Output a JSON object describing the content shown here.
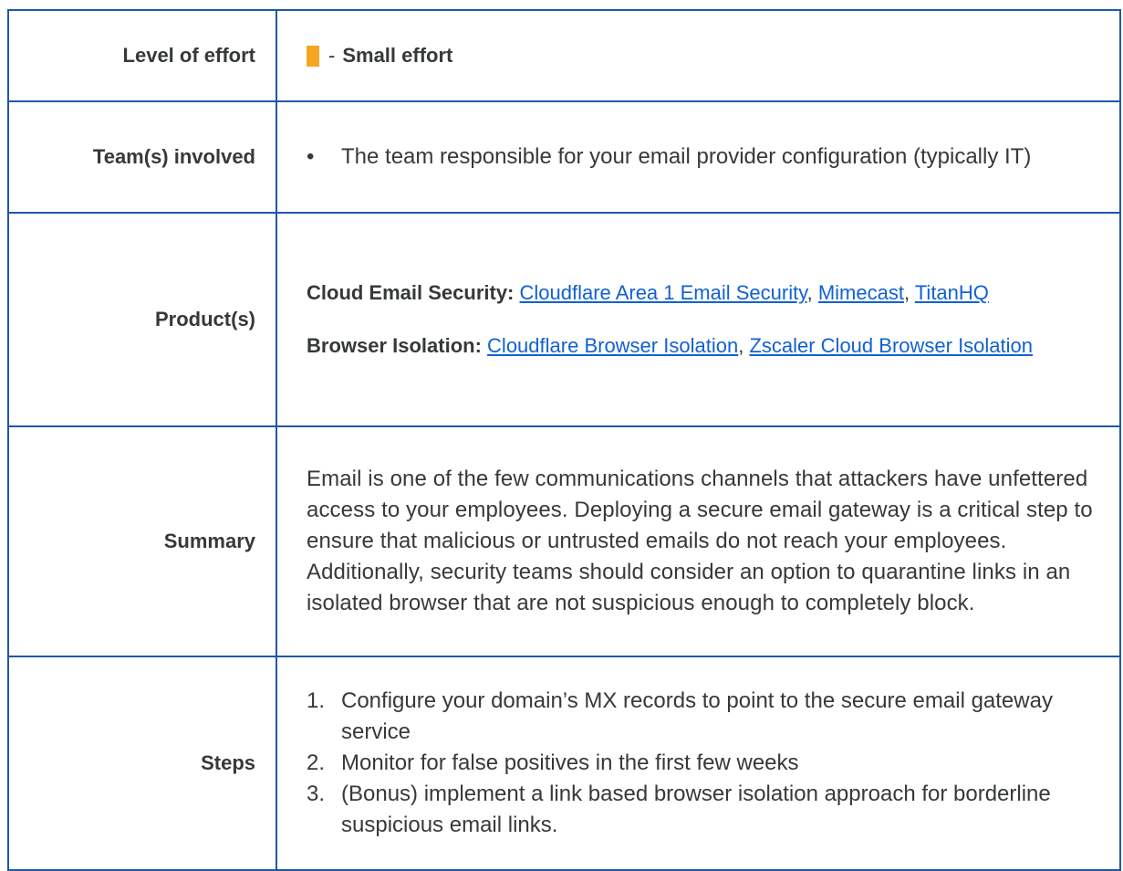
{
  "level_of_effort": {
    "label": "Level of effort",
    "separator": "-",
    "value": "Small effort",
    "swatch_color": "#f6a623"
  },
  "teams": {
    "label": "Team(s) involved",
    "items": [
      "The team responsible for your email provider configuration (typically IT)"
    ]
  },
  "products": {
    "label": "Product(s)",
    "email_security": {
      "heading": "Cloud Email Security:",
      "links": [
        "Cloudflare Area 1 Email Security",
        "Mimecast",
        "TitanHQ"
      ]
    },
    "browser_isolation": {
      "heading": "Browser Isolation:",
      "links": [
        "Cloudflare Browser Isolation",
        "Zscaler Cloud Browser Isolation"
      ]
    },
    "separator": ","
  },
  "summary": {
    "label": "Summary",
    "text": "Email is one of the few communications channels that attackers have unfettered access to your employees. Deploying a secure email gateway is a critical step to ensure that malicious or untrusted emails do not reach your employees. Additionally, security teams should consider an option to quarantine links in an isolated browser that are not suspicious enough to completely block."
  },
  "steps": {
    "label": "Steps",
    "items": [
      {
        "num": "1.",
        "text": "Configure your domain’s MX records to point to the secure email gateway service"
      },
      {
        "num": "2.",
        "text": "Monitor for false positives in the first few weeks"
      },
      {
        "num": "3.",
        "text": "(Bonus) implement a link based browser isolation approach for borderline suspicious email links."
      }
    ]
  },
  "colors": {
    "border": "#1f58a6",
    "link": "#1161d0",
    "text": "#36393a",
    "effort_swatch": "#f6a623"
  }
}
